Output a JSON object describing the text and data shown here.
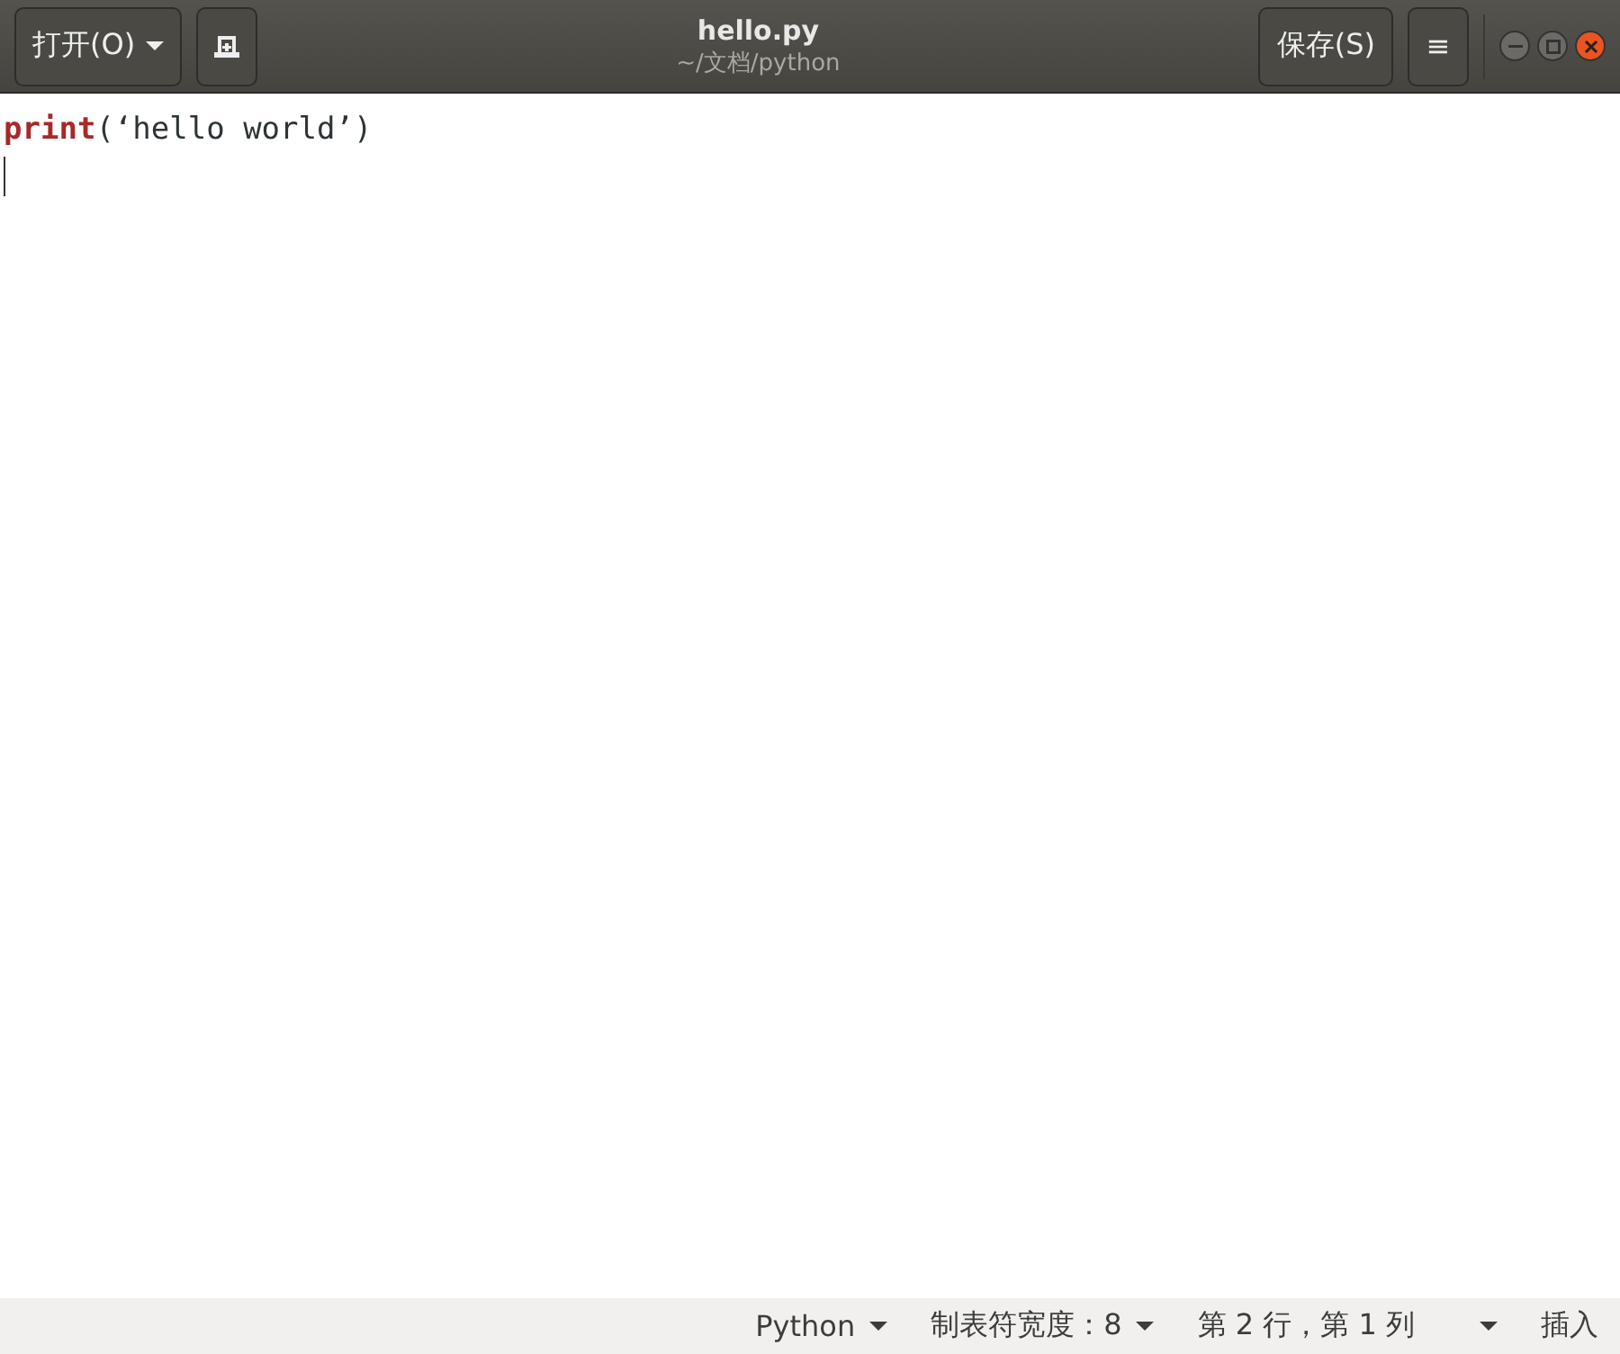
{
  "header": {
    "open_button": "打开(O)",
    "title": "hello.py",
    "subtitle": "~/文档/python",
    "save_button": "保存(S)",
    "menu_button": "≡"
  },
  "editor": {
    "lines": [
      {
        "tokens": [
          {
            "kind": "keyword",
            "text": "print"
          },
          {
            "kind": "plain",
            "text": "(‘hello world’)"
          }
        ]
      }
    ]
  },
  "status_bar": {
    "language": "Python",
    "tab_width": "制表符宽度：8",
    "position": "第 2 行，第 1 列",
    "mode": "插入"
  }
}
